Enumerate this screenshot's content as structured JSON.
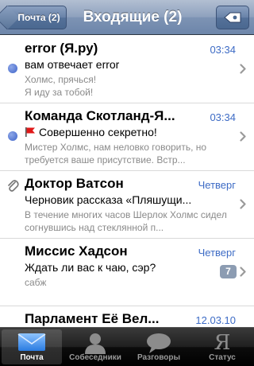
{
  "navbar": {
    "back_label": "Почта (2)",
    "title": "Входящие (2)",
    "compose_icon": "compose-arrow-icon"
  },
  "messages": [
    {
      "sender": "error (Я.ру)",
      "date": "03:34",
      "subject": "вам отвечает error",
      "preview": "Холмс, прячься!\nЯ иду за тобой!",
      "unread": true,
      "flagged": false,
      "attachment": false,
      "count": ""
    },
    {
      "sender": "Команда Скотланд-Я...",
      "date": "03:34",
      "subject": "Совершенно секретно!",
      "preview": "Мистер Холмс, нам неловко говорить, но требуется ваше присутствие. Встр...",
      "unread": true,
      "flagged": true,
      "attachment": false,
      "count": ""
    },
    {
      "sender": "Доктор Ватсон",
      "date": "Четверг",
      "subject": "Черновик рассказа «Пляшущи...",
      "preview": "В течение многих часов Шерлок Холмс сидел   согнувшись   над стеклянной п...",
      "unread": false,
      "flagged": false,
      "attachment": true,
      "count": ""
    },
    {
      "sender": "Миссис Хадсон",
      "date": "Четверг",
      "subject": "Ждать ли вас к чаю, сэр?",
      "preview": "сабж",
      "unread": false,
      "flagged": false,
      "attachment": false,
      "count": "7"
    },
    {
      "sender": "Парламент Её Вел...",
      "date": "12.03.10",
      "subject": "",
      "preview": "",
      "unread": false,
      "flagged": false,
      "attachment": false,
      "count": ""
    }
  ],
  "tabs": [
    {
      "label": "Почта",
      "icon": "envelope-icon",
      "active": true
    },
    {
      "label": "Собеседники",
      "icon": "person-icon",
      "active": false
    },
    {
      "label": "Разговоры",
      "icon": "speech-bubble-icon",
      "active": false
    },
    {
      "label": "Статус",
      "icon": "ya-logo-icon",
      "active": false
    }
  ],
  "tab_icon_ya": "Я",
  "colors": {
    "navbar": "#6d86aa",
    "date": "#3d6bc5",
    "unread_dot": "#3d63c9",
    "flag": "#e01818",
    "badge": "#8c9cb2",
    "tabbar": "#000000"
  }
}
